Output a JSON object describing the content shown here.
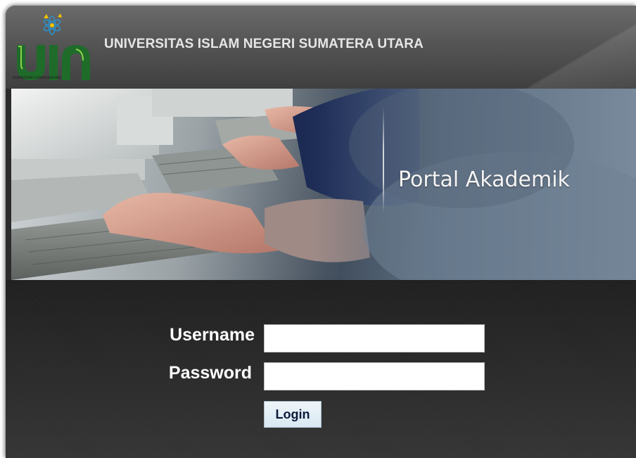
{
  "header": {
    "university_name": "UNIVERSITAS ISLAM NEGERI SUMATERA UTARA",
    "logo_text": "UIN",
    "logo_caption": "SUMATERA UTARA MEDAN"
  },
  "banner": {
    "portal_title": "Portal Akademik"
  },
  "login_form": {
    "username_label": "Username",
    "username_value": "",
    "password_label": "Password",
    "password_value": "",
    "login_label": "Login"
  },
  "colors": {
    "header_bg": "#555555",
    "login_bg": "#2b2b2b",
    "logo_green": "#1f6b2a",
    "logo_accent": "#8bd34a",
    "button_bg": "#d9e8f2"
  }
}
